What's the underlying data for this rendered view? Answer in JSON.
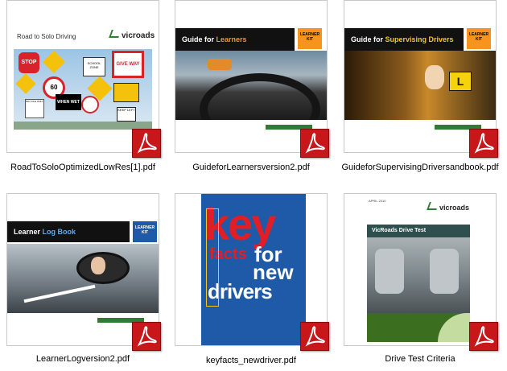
{
  "files": [
    {
      "name": "RoadToSoloOptimizedLowRes[1].pdf",
      "cover_title": "Road to Solo Driving",
      "brand": "vicroads",
      "signs": [
        "STOP",
        "GIVE WAY",
        "SCHOOL ZONE",
        "SAFETY ZONE",
        "WHEN WET",
        "60",
        "KEEP LEFT",
        "BICYCLE ONLY"
      ]
    },
    {
      "name": "GuideforLearnersversion2.pdf",
      "cover_title_a": "Guide for ",
      "cover_title_b": "Learners",
      "kit": "LEARNER KIT"
    },
    {
      "name": "GuideforSupervisingDriversandbook.pdf",
      "cover_title_a": "Guide for ",
      "cover_title_b": "Supervising Drivers",
      "kit": "LEARNER KIT",
      "plate": "L"
    },
    {
      "name": "LearnerLogversion2.pdf",
      "cover_title_a": "Learner ",
      "cover_title_b": "Log Book",
      "kit": "LEARNER KIT"
    },
    {
      "name": "keyfacts_newdriver.pdf",
      "line1": "key",
      "line2a": "facts",
      "line2b": "for",
      "line3": "new",
      "line4": "drivers"
    },
    {
      "name": "Drive Test Criteria",
      "date": "APRIL 2010",
      "brand": "vicroads",
      "cover_title": "VicRoads Drive Test"
    }
  ],
  "colors": {
    "pdf_red": "#c8171b",
    "accent_orange": "#f7941d",
    "accent_blue": "#1e5aa8",
    "keyfacts_red": "#e01e26",
    "vic_green": "#2e7d32"
  },
  "icon": "adobe-pdf-icon"
}
